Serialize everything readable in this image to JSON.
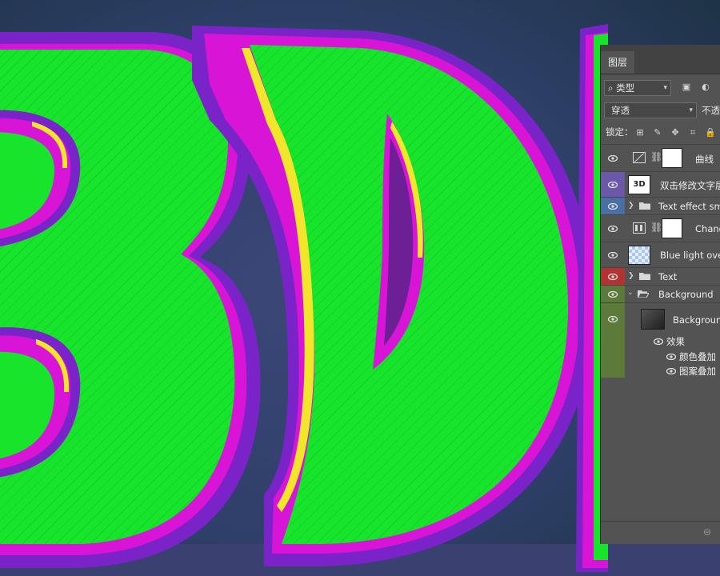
{
  "artwork": {
    "text": "3D",
    "colors": {
      "background_center": "#3c4778",
      "background_edge": "#1f3348",
      "face": "#17e42b",
      "rim": "#d815d6",
      "outline": "#7a23c9",
      "highlight": "#f2e52c"
    }
  },
  "panel": {
    "tab_label": "图层",
    "filter_kind": "类型",
    "blend_mode": "穿透",
    "opacity_label": "不透",
    "lock_label": "锁定："
  },
  "layers": [
    {
      "name": "曲线",
      "type": "adjustment",
      "eye_color": "#535353"
    },
    {
      "name": "双击修改文字层",
      "type": "smart",
      "thumb_text": "3D",
      "eye_color": "#6c58a8"
    },
    {
      "name": "Text effect smart",
      "type": "group",
      "eye_color": "#4a6fa3"
    },
    {
      "name": "Change",
      "type": "adjustment",
      "eye_color": "#535353"
    },
    {
      "name": "Blue light overa",
      "type": "transparent",
      "eye_color": "#535353"
    },
    {
      "name": "Text",
      "type": "group",
      "eye_color": "#b33232"
    },
    {
      "name": "Background",
      "type": "group-open",
      "eye_color": "#5c7a3a"
    },
    {
      "name": "Background",
      "type": "dark",
      "eye_color": "#5c7a3a"
    }
  ],
  "effects": {
    "header": "效果",
    "items": [
      "颜色叠加",
      "图案叠加"
    ]
  }
}
